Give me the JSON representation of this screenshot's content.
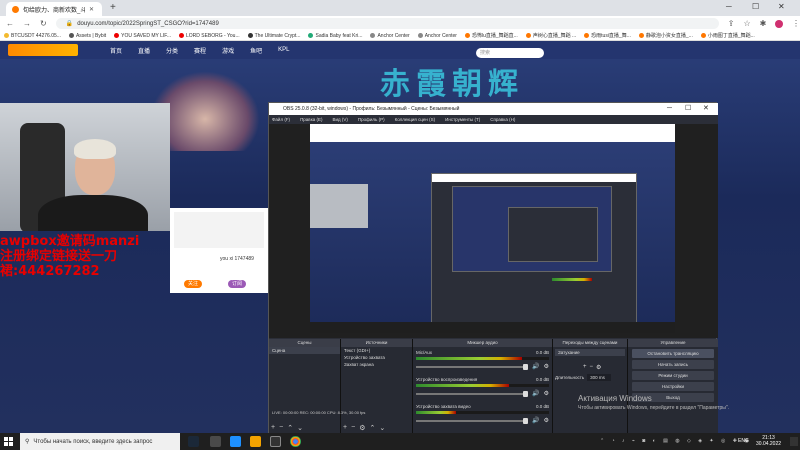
{
  "browser": {
    "tabs": [
      {
        "title": "旬给欧力、商新欢数_斗鱼直播平台"
      },
      {
        "title": ""
      }
    ],
    "new_tab": "+",
    "url": "douyu.com/topic/2022SpringST_CSGO?rid=1747489",
    "bookmarks": [
      {
        "label": "BTCUSDT 44276.05...",
        "color": "#f3ba2f"
      },
      {
        "label": "Assets | Bybit",
        "color": "#555"
      },
      {
        "label": "YOU SAVED MY LIF...",
        "color": "#e00"
      },
      {
        "label": "LORD SEBORG - You...",
        "color": "#e00"
      },
      {
        "label": "The Ultimate Crypt...",
        "color": "#333"
      },
      {
        "label": "Sadia Baby feat Kri...",
        "color": "#2a7"
      },
      {
        "label": "Anchor Center",
        "color": "#888"
      },
      {
        "label": "Anchor Center",
        "color": "#888"
      },
      {
        "label": "恐怖lu直播_舞蹈直...",
        "color": "#f70"
      },
      {
        "label": "声树心直播_舞蹈 ...",
        "color": "#f70"
      },
      {
        "label": "恐雨tusi直播_舞...",
        "color": "#f70"
      },
      {
        "label": "静歌泡小资女直播_...",
        "color": "#f70"
      },
      {
        "label": "小雨图丁直播_舞蹈...",
        "color": "#f70"
      }
    ]
  },
  "site": {
    "nav": [
      "首页",
      "直播",
      "分类",
      "赛程",
      "游戏",
      "鱼吧",
      "KPL"
    ],
    "search_placeholder": "搜索",
    "banner": "赤霞朝辉",
    "chat_user": "you xi 1747489",
    "pills": [
      "关注",
      "订阅"
    ]
  },
  "overlay": {
    "line1": "awpbox邀请码manzi",
    "line2": "注册绑定链接送一刀",
    "line3": "裙:444267282"
  },
  "obs": {
    "title": "OBS 25.0.8 (32-bit, windows) - Профиль: Безымянный - Сцены: Безымянный",
    "menu": [
      "Файл (F)",
      "Правка (E)",
      "Вид (V)",
      "Профиль (P)",
      "Коллекция сцен (S)",
      "Инструменты (T)",
      "Справка (H)"
    ],
    "docks": {
      "scenes": {
        "header": "Сцены",
        "items": [
          "Сцена"
        ]
      },
      "sources": {
        "header": "Источники",
        "items": [
          "Текст (GDI+)",
          "Устройство захвата",
          "Захват экрана"
        ]
      },
      "mixer": {
        "header": "Микшер аудио",
        "channels": [
          {
            "name": "Mic/Aux",
            "level": "0.0 dB",
            "fill": 0.8
          },
          {
            "name": "Устройство воспроизведения",
            "level": "0.0 dB",
            "fill": 0.7
          },
          {
            "name": "Устройство захвата видео",
            "level": "0.0 dB",
            "fill": 0.3
          }
        ]
      },
      "transitions": {
        "header": "Переходы между сценами",
        "type": "Затухание",
        "duration_label": "Длительность",
        "duration": "300 ms"
      },
      "controls": {
        "header": "Управление",
        "buttons": [
          "Остановить трансляцию",
          "Начать запись",
          "Режим студии",
          "Настройки",
          "Выход"
        ]
      }
    },
    "status": "LIVE: 00:00:00   REC: 00:00:00   CPU: 8.3%, 30.00 fps"
  },
  "windows": {
    "activation_title": "Активация Windows",
    "activation_sub": "Чтобы активировать Windows, перейдите в раздел \"Параметры\".",
    "search_placeholder": "Чтобы начать поиск, введите здесь запрос",
    "time": "21:13",
    "date": "30.04.2022",
    "lang": "ENG"
  }
}
